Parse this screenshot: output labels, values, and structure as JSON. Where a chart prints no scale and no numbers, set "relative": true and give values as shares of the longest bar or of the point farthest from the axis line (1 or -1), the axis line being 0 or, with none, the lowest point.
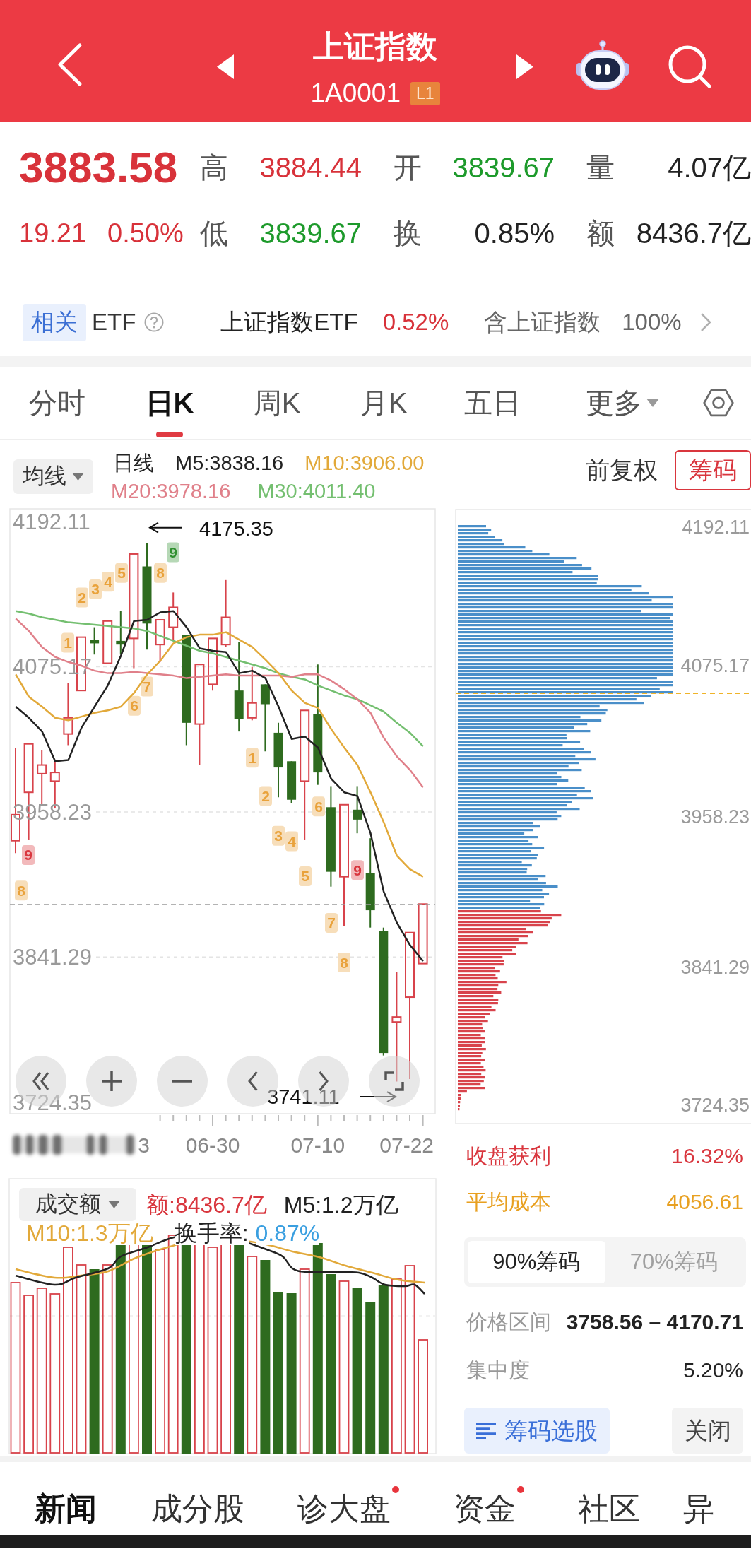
{
  "header": {
    "title": "上证指数",
    "code": "1A0001",
    "level_badge": "L1"
  },
  "quote": {
    "price": "3883.58",
    "change": "19.21",
    "change_percent": "0.50%",
    "color": "#d8323a",
    "stats": [
      {
        "label": "高",
        "value": "3884.44",
        "color": "#d8323a"
      },
      {
        "label": "开",
        "value": "3839.67",
        "color": "#1d9a2b"
      },
      {
        "label": "量",
        "value": "4.07亿",
        "color": "#222222"
      },
      {
        "label": "低",
        "value": "3839.67",
        "color": "#1d9a2b"
      },
      {
        "label": "换",
        "value": "0.85%",
        "color": "#222222"
      },
      {
        "label": "额",
        "value": "8436.7亿",
        "color": "#222222"
      }
    ]
  },
  "related_etf": {
    "tag": "相关",
    "label": "ETF",
    "fund_name": "上证指数ETF",
    "fund_change": "0.52%",
    "holding_label": "含上证指数",
    "holding_share": "100%"
  },
  "period_tabs": [
    {
      "label": "分时",
      "selected": false,
      "kind": "plain"
    },
    {
      "label": "日K",
      "selected": true,
      "kind": "plain"
    },
    {
      "label": "周K",
      "selected": false,
      "kind": "plain"
    },
    {
      "label": "月K",
      "selected": false,
      "kind": "plain"
    },
    {
      "label": "五日",
      "selected": false,
      "kind": "plain"
    },
    {
      "label": "更多",
      "selected": false,
      "kind": "dropdown"
    }
  ],
  "kline": {
    "indicator_dropdown": "均线",
    "period_label": "日线",
    "adjust_mode": "前复权",
    "chips_toggle": {
      "label": "筹码",
      "on": true
    },
    "high_marker": "4175.35",
    "low_marker": "3741.11",
    "sequence_marks": [
      {
        "text": "8",
        "color": "#e9a23b"
      },
      {
        "text": "9",
        "color": "#d9363e"
      },
      {
        "text": "1",
        "color": "#e9a23b"
      },
      {
        "text": "2",
        "color": "#e9a23b"
      },
      {
        "text": "3",
        "color": "#e9a23b"
      },
      {
        "text": "4",
        "color": "#e9a23b"
      },
      {
        "text": "5",
        "color": "#e9a23b"
      },
      {
        "text": "6",
        "color": "#e9a23b"
      },
      {
        "text": "7",
        "color": "#e9a23b"
      },
      {
        "text": "8",
        "color": "#e9a23b"
      },
      {
        "text": "9",
        "color": "#2f8f2f"
      },
      {
        "text": "1",
        "color": "#e9a23b"
      },
      {
        "text": "2",
        "color": "#e9a23b"
      },
      {
        "text": "3",
        "color": "#e9a23b"
      },
      {
        "text": "4",
        "color": "#e9a23b"
      },
      {
        "text": "5",
        "color": "#e9a23b"
      },
      {
        "text": "6",
        "color": "#e9a23b"
      },
      {
        "text": "7",
        "color": "#e9a23b"
      },
      {
        "text": "8",
        "color": "#e9a23b"
      },
      {
        "text": "9",
        "color": "#d9363e"
      }
    ],
    "date_fragment": "3",
    "chart_data": {
      "type": "candlestick",
      "grid": true,
      "categories": [
        null,
        null,
        null,
        null,
        null,
        null,
        null,
        null,
        null,
        null,
        null,
        null,
        null,
        null,
        null,
        "06-30",
        null,
        null,
        null,
        null,
        null,
        null,
        null,
        "07-10",
        null,
        null,
        null,
        null,
        null,
        null,
        null,
        "07-22"
      ],
      "ylim": [
        3715.1,
        4202.4
      ],
      "yticks": [
        {
          "value": 4192.11,
          "label": "4192.11"
        },
        {
          "value": 4075.17,
          "label": "4075.17"
        },
        {
          "value": 3958.23,
          "label": "3958.23"
        },
        {
          "value": 3841.29,
          "label": "3841.29"
        },
        {
          "value": 3724.35,
          "label": "3724.35"
        }
      ],
      "ref_lines": [
        {
          "axis": "y",
          "value": 3883.58
        }
      ],
      "ohlc": [
        [
          3935,
          4010,
          3925,
          3956
        ],
        [
          3974,
          4013,
          3936,
          4013
        ],
        [
          3989,
          4008,
          3963,
          3996
        ],
        [
          3983,
          3999,
          3961,
          3990
        ],
        [
          4021,
          4062,
          4012,
          4034
        ],
        [
          4056,
          4099,
          4056,
          4099
        ],
        [
          4097,
          4107,
          4085,
          4094
        ],
        [
          4078,
          4112,
          4078,
          4112
        ],
        [
          4096,
          4120,
          4085,
          4093
        ],
        [
          4098,
          4166,
          4074,
          4166
        ],
        [
          4156,
          4175,
          4089,
          4110
        ],
        [
          4093,
          4113,
          4079,
          4113
        ],
        [
          4107,
          4135,
          4097,
          4123
        ],
        [
          4101,
          4101,
          4012,
          4030
        ],
        [
          4029,
          4077,
          3996,
          4077
        ],
        [
          4061,
          4098,
          4056,
          4098
        ],
        [
          4093,
          4145,
          4091,
          4115
        ],
        [
          4056,
          4095,
          4023,
          4033
        ],
        [
          4034,
          4075,
          4032,
          4046
        ],
        [
          4061,
          4061,
          4007,
          4045
        ],
        [
          4022,
          4030,
          3970,
          3994
        ],
        [
          3999,
          3999,
          3965,
          3968
        ],
        [
          3983,
          4040,
          3936,
          4040
        ],
        [
          4037,
          4077,
          3980,
          3990
        ],
        [
          3962,
          3979,
          3898,
          3910
        ],
        [
          3906,
          3964,
          3866,
          3964
        ],
        [
          3960,
          3979,
          3941,
          3952
        ],
        [
          3909,
          3937,
          3865,
          3879
        ],
        [
          3862,
          3865,
          3762,
          3764
        ],
        [
          3789,
          3829,
          3741,
          3793
        ],
        [
          3809,
          3861,
          3743,
          3861
        ],
        [
          3836,
          3884,
          3836,
          3884
        ]
      ]
    },
    "moving_averages": {
      "chart_data": {
        "type": "line",
        "relative": true,
        "ylim": [
          3715.1,
          4202.4
        ],
        "categories": [
          null,
          null,
          null,
          null,
          null,
          null,
          null,
          null,
          null,
          null,
          null,
          null,
          null,
          null,
          null,
          null,
          null,
          null,
          null,
          null,
          null,
          null,
          null,
          null,
          null,
          null,
          null,
          null,
          null,
          null,
          null,
          null
        ],
        "series": [
          {
            "name": "M5:3838.16",
            "color": "#222222",
            "values": [
              4043,
              4034,
              4023,
              3999,
              4000,
              4026,
              4043,
              4060,
              4084,
              4112,
              4113,
              4119,
              4120,
              4107,
              4090,
              4088,
              4087,
              4070,
              4072,
              4066,
              4043,
              4017,
              4019,
              4010,
              3985,
              3974,
              3971,
              3941,
              3894,
              3869,
              3851,
              3838
            ]
          },
          {
            "name": "M10:3906.00",
            "color": "#e2a93a",
            "values": [
              4069,
              4051,
              4043,
              4034,
              4032,
              4035,
              4038,
              4040,
              4043,
              4054,
              4069,
              4080,
              4094,
              4099,
              4101,
              4101,
              4103,
              4097,
              4091,
              4081,
              4070,
              4056,
              4046,
              4042,
              4025,
              4010,
              3996,
              3974,
              3950,
              3923,
              3912,
              3906
            ]
          },
          {
            "name": "M20:3978.16",
            "color": "#e0808a",
            "values": [
              4114,
              4104,
              4091,
              4083,
              4079,
              4076,
              4072,
              4070,
              4070,
              4071,
              4070,
              4069,
              4068,
              4066,
              4067,
              4068,
              4069,
              4068,
              4068,
              4068,
              4068,
              4067,
              4069,
              4069,
              4064,
              4057,
              4049,
              4038,
              4018,
              4003,
              3992,
              3978
            ]
          },
          {
            "name": "M30:4011.40",
            "color": "#74bf70",
            "values": [
              4120,
              4118,
              4115,
              4113,
              4111,
              4110,
              4109,
              4108,
              4107,
              4106,
              4104,
              4100,
              4096,
              4092,
              4088,
              4086,
              4083,
              4080,
              4077,
              4074,
              4070,
              4067,
              4065,
              4060,
              4056,
              4052,
              4049,
              4044,
              4039,
              4030,
              4022,
              4011
            ]
          }
        ]
      }
    }
  },
  "chips": {
    "price_axis": [
      "4192.11",
      "4075.17",
      "3958.23",
      "3841.29",
      "3724.35"
    ],
    "close_profit": {
      "label": "收盘获利",
      "value": "16.32%"
    },
    "average_cost": {
      "label": "平均成本",
      "value": "4056.61"
    },
    "range_tabs": [
      {
        "label": "90%筹码",
        "selected": true
      },
      {
        "label": "70%筹码",
        "selected": false
      }
    ],
    "price_range": {
      "label": "价格区间",
      "value": "3758.56 – 4170.71"
    },
    "concentration": {
      "label": "集中度",
      "value": "5.20%"
    },
    "pick_button": "筹码选股",
    "close_button": "关闭"
  },
  "volume": {
    "indicator_dropdown": "成交额",
    "legend": [
      {
        "text": "额:8436.7亿",
        "color": "#d9363e"
      },
      {
        "text": "M5:1.2万亿",
        "color": "#222222"
      },
      {
        "text": "M10:1.3万亿",
        "color": "#e2a93a"
      },
      {
        "text": "换手率:",
        "color": "#222222"
      },
      {
        "text": "0.87%",
        "color": "#3a9fe0"
      }
    ]
  },
  "bottom_tabs": [
    {
      "label": "新闻",
      "selected": true,
      "dot": false
    },
    {
      "label": "成分股",
      "selected": false,
      "dot": false
    },
    {
      "label": "诊大盘",
      "selected": false,
      "dot": true
    },
    {
      "label": "资金",
      "selected": false,
      "dot": true
    },
    {
      "label": "社区",
      "selected": false,
      "dot": false
    },
    {
      "label": "异",
      "selected": false,
      "dot": false
    }
  ]
}
